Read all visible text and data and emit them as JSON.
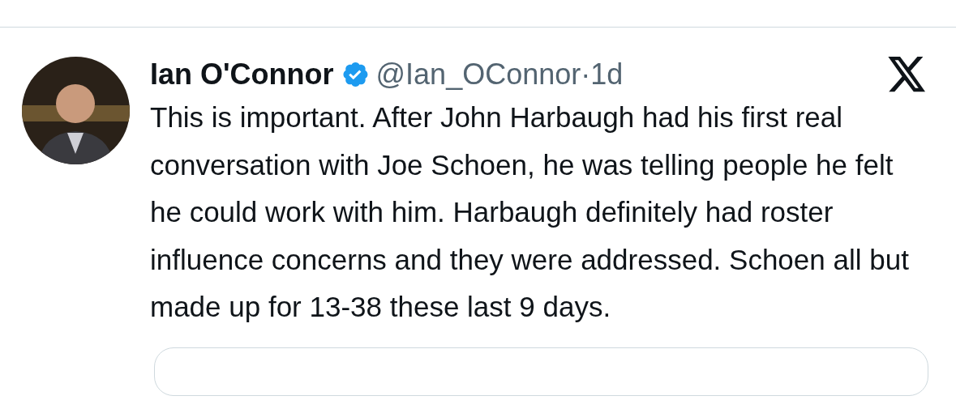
{
  "post": {
    "author": "Ian O'Connor",
    "verified": true,
    "handle": "@Ian_OConnor",
    "separator": "·",
    "time": "1d",
    "text": "This is important. After John Harbaugh had his first real conversation with Joe Schoen, he was telling people he felt he could work with him. Harbaugh definitely had roster influence concerns and they were addressed. Schoen all but made up for 13-38 these last 9 days."
  }
}
